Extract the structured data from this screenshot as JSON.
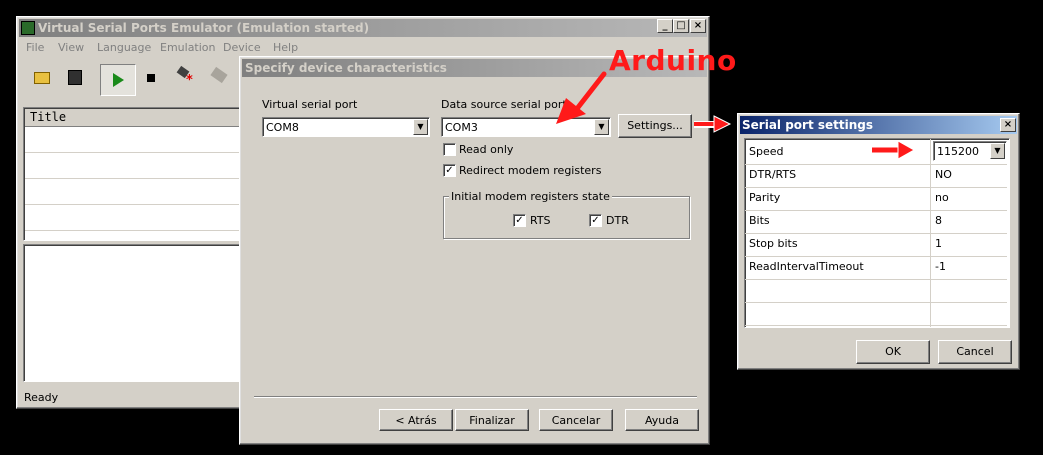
{
  "main_window": {
    "title": "Virtual Serial Ports Emulator (Emulation started)",
    "menu": [
      "File",
      "View",
      "Language",
      "Emulation",
      "Device",
      "Help"
    ],
    "list_header": "Title",
    "status": "Ready"
  },
  "device_dialog": {
    "title": "Specify device characteristics",
    "virtual_port_label": "Virtual serial port",
    "virtual_port_value": "COM8",
    "data_source_label": "Data source serial port",
    "data_source_value": "COM3",
    "settings_button": "Settings...",
    "read_only_label": "Read only",
    "read_only_checked": false,
    "redirect_label": "Redirect modem registers",
    "redirect_checked": true,
    "group_label": "Initial modem registers state",
    "rts_label": "RTS",
    "rts_checked": true,
    "dtr_label": "DTR",
    "dtr_checked": true,
    "back_button": "< Atrás",
    "finish_button": "Finalizar",
    "cancel_button": "Cancelar",
    "help_button": "Ayuda"
  },
  "settings_dialog": {
    "title": "Serial port settings",
    "rows": [
      {
        "key": "Speed",
        "value": "115200"
      },
      {
        "key": "DTR/RTS",
        "value": "NO"
      },
      {
        "key": "Parity",
        "value": "no"
      },
      {
        "key": "Bits",
        "value": "8"
      },
      {
        "key": "Stop bits",
        "value": "1"
      },
      {
        "key": "ReadIntervalTimeout",
        "value": "-1"
      }
    ],
    "ok_button": "OK",
    "cancel_button": "Cancel"
  },
  "annotation": {
    "callout_text": "Arduino",
    "color": "#ff1a1a"
  }
}
